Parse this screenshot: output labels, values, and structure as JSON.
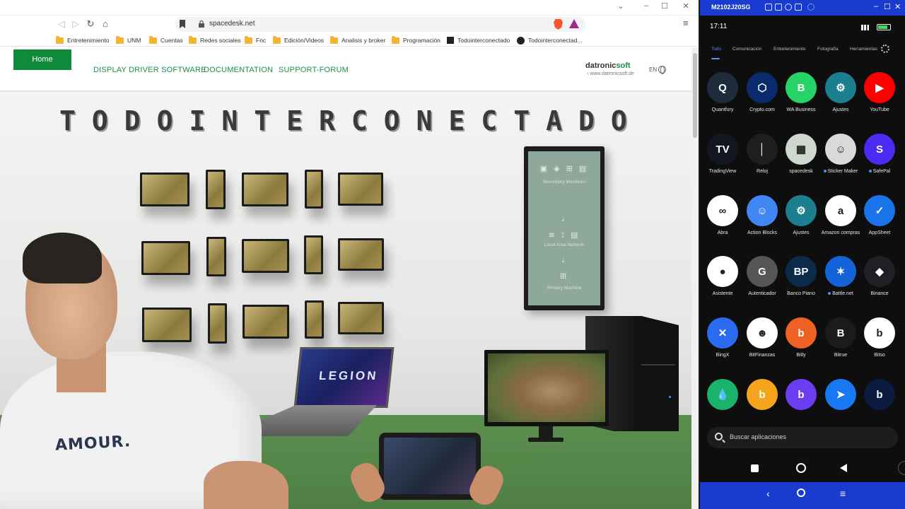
{
  "browser": {
    "url": "spacedesk.net",
    "window_controls": [
      "⌄",
      "–",
      "☐",
      "✕"
    ],
    "bookmarks": [
      {
        "label": "Entretenimiento",
        "type": "folder"
      },
      {
        "label": "UNM",
        "type": "folder"
      },
      {
        "label": "Cuentas",
        "type": "folder"
      },
      {
        "label": "Redes sociales",
        "type": "folder"
      },
      {
        "label": "Fnc",
        "type": "folder"
      },
      {
        "label": "Edición/Videos",
        "type": "folder"
      },
      {
        "label": "Analisis y broker",
        "type": "folder"
      },
      {
        "label": "Programación",
        "type": "folder"
      },
      {
        "label": "Todointerconectado",
        "type": "site"
      },
      {
        "label": "Todointerconectad...",
        "type": "github"
      }
    ]
  },
  "site": {
    "home_label": "Home",
    "nav": [
      "DISPLAY DRIVER SOFTWARE",
      "DOCUMENTATION",
      "SUPPORT-FORUM"
    ],
    "logo_prefix": "datronic",
    "logo_suffix": "soft",
    "logo_url": "› www.datronicsoft.de",
    "lang": "EN",
    "headline": "TODOINTERCONECTADO",
    "panel_labels": [
      "Secondary Machines",
      "Local Area Network",
      "Primary Machine"
    ],
    "laptop_text": "LEGION",
    "shirt_text": "AMOUR."
  },
  "phone": {
    "device_name": "M2102J20SG",
    "time": "17:11",
    "categories": [
      "Todo",
      "Comunicación",
      "Entretenimiento",
      "Fotografía",
      "Herramientas"
    ],
    "apps": [
      {
        "label": "Quantfury",
        "color": "#1d2b3a",
        "glyph": "Q"
      },
      {
        "label": "Crypto.com",
        "color": "#0a2a6b",
        "glyph": "⬡"
      },
      {
        "label": "WA Business",
        "color": "#25d366",
        "glyph": "B"
      },
      {
        "label": "Ajustes",
        "color": "#1b7f8f",
        "glyph": "⚙"
      },
      {
        "label": "YouTube",
        "color": "#ff0000",
        "glyph": "▶"
      },
      {
        "label": "TradingView",
        "color": "#131722",
        "glyph": "TV"
      },
      {
        "label": "Reloj",
        "color": "#1e1e1e",
        "glyph": "│"
      },
      {
        "label": "spacedesk",
        "color": "#cfd8cf",
        "glyph": "▦"
      },
      {
        "label": "Sticker Maker",
        "color": "#d9d9d9",
        "glyph": "☺",
        "dot": true
      },
      {
        "label": "SafePal",
        "color": "#4a2cf0",
        "glyph": "S",
        "dot": true
      },
      {
        "label": "Abra",
        "color": "#ffffff",
        "glyph": "∞"
      },
      {
        "label": "Action Blocks",
        "color": "#4285f4",
        "glyph": "☺"
      },
      {
        "label": "Ajustes",
        "color": "#1b7f8f",
        "glyph": "⚙"
      },
      {
        "label": "Amazon compras",
        "color": "#ffffff",
        "glyph": "a"
      },
      {
        "label": "AppSheet",
        "color": "#1a73e8",
        "glyph": "✓"
      },
      {
        "label": "Asistente",
        "color": "#ffffff",
        "glyph": "●"
      },
      {
        "label": "Autenticador",
        "color": "#555555",
        "glyph": "G"
      },
      {
        "label": "Banco Piano",
        "color": "#0a2b4a",
        "glyph": "BP"
      },
      {
        "label": "Battle.net",
        "color": "#1464d8",
        "glyph": "✶",
        "dot": true
      },
      {
        "label": "Binance",
        "color": "#1e2026",
        "glyph": "◆"
      },
      {
        "label": "BingX",
        "color": "#2a6bf0",
        "glyph": "✕"
      },
      {
        "label": "BitFinanzas",
        "color": "#ffffff",
        "glyph": "☻"
      },
      {
        "label": "Bitly",
        "color": "#ee6123",
        "glyph": "b"
      },
      {
        "label": "Bitrue",
        "color": "#1b1b1b",
        "glyph": "B"
      },
      {
        "label": "Bitso",
        "color": "#ffffff",
        "glyph": "b"
      },
      {
        "label": "",
        "color": "#19b36b",
        "glyph": "💧"
      },
      {
        "label": "",
        "color": "#f4a51c",
        "glyph": "b"
      },
      {
        "label": "",
        "color": "#6b3cf0",
        "glyph": "b"
      },
      {
        "label": "",
        "color": "#1877f2",
        "glyph": "➤"
      },
      {
        "label": "",
        "color": "#0b1b40",
        "glyph": "b"
      }
    ],
    "search_placeholder": "Buscar aplicaciones"
  }
}
